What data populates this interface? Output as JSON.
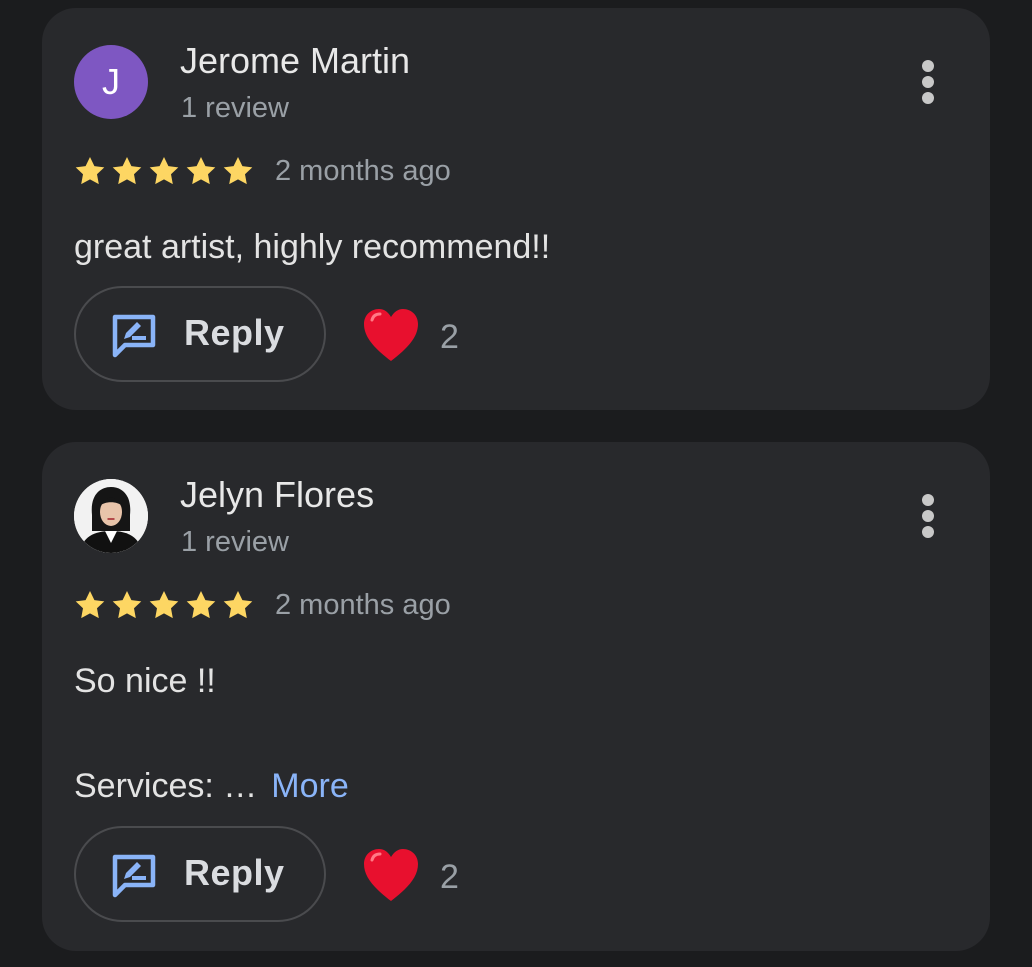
{
  "colors": {
    "background": "#1b1c1e",
    "card": "#28292c",
    "star": "#fdd663",
    "link": "#8ab4f8",
    "reply_icon": "#8ab4f8",
    "heart": "#e8102e",
    "avatar_letter_bg": "#7e57c2"
  },
  "reviews": [
    {
      "avatar": {
        "type": "letter",
        "letter": "J"
      },
      "name": "Jerome Martin",
      "review_count": "1 review",
      "rating": 5,
      "time_ago": "2 months ago",
      "text_lines": [
        "great artist, highly recommend!!"
      ],
      "more_label": "",
      "reply_label": "Reply",
      "heart_icon": "red-heart-icon",
      "likes": "2"
    },
    {
      "avatar": {
        "type": "photo"
      },
      "name": "Jelyn Flores",
      "review_count": "1 review",
      "rating": 5,
      "time_ago": "2 months ago",
      "text_lines": [
        "So nice !!",
        "Services: …"
      ],
      "more_label": "More",
      "reply_label": "Reply",
      "heart_icon": "red-heart-icon",
      "likes": "2"
    }
  ]
}
